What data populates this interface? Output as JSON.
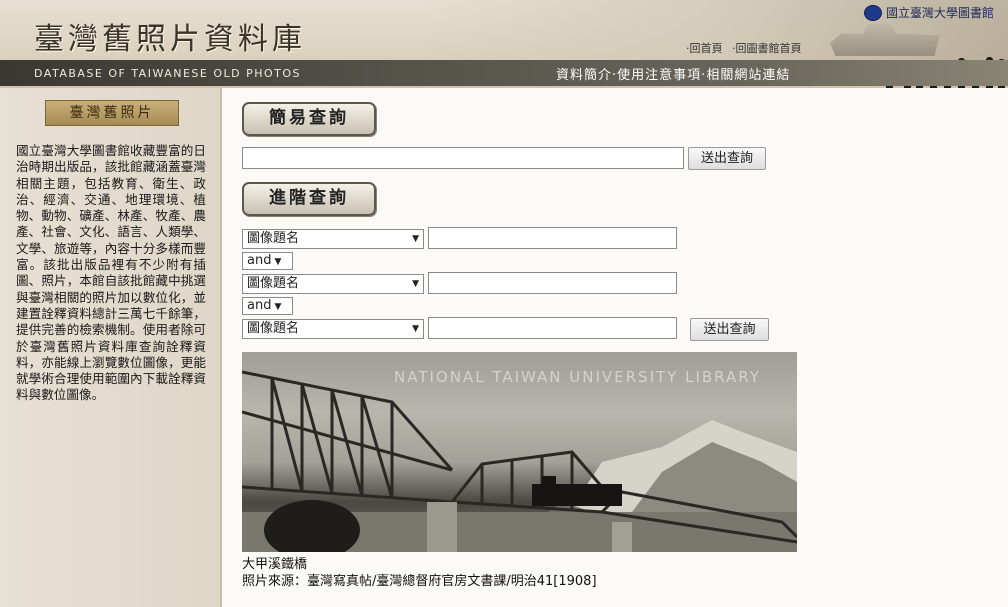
{
  "header": {
    "site_title": "臺灣舊照片資料庫",
    "subtitle_en": "DATABASE OF TAIWANESE OLD PHOTOS",
    "library_name": "國立臺灣大學圖書館",
    "home_links": [
      "‧回首頁",
      "‧回圖書館首頁"
    ],
    "nav": [
      "資料簡介",
      "使用注意事項",
      "相關網站連結"
    ],
    "nav_sep": "‧"
  },
  "sidebar": {
    "badge": "臺灣舊照片",
    "description": "國立臺灣大學圖書館收藏豐富的日治時期出版品，該批館藏涵蓋臺灣相關主題，包括教育、衛生、政治、經濟、交通、地理環境、植物、動物、礦產、林產、牧產、農產、社會、文化、語言、人類學、文學、旅遊等，內容十分多樣而豐富。該批出版品裡有不少附有插圖、照片，本館自該批館藏中挑選與臺灣相關的照片加以數位化，並建置詮釋資料總計三萬七千餘筆，提供完善的檢索機制。使用者除可於臺灣舊照片資料庫查詢詮釋資料，亦能線上瀏覽數位圖像，更能就學術合理使用範圍內下載詮釋資料與數位圖像。"
  },
  "simple_search": {
    "heading": "簡易查詢",
    "query_value": "",
    "submit_label": "送出查詢"
  },
  "advanced_search": {
    "heading": "進階查詢",
    "rows": [
      {
        "field": "圖像題名",
        "value": ""
      },
      {
        "field": "圖像題名",
        "value": ""
      },
      {
        "field": "圖像題名",
        "value": ""
      }
    ],
    "operators": [
      "and",
      "and"
    ],
    "submit_label": "送出查詢"
  },
  "featured_photo": {
    "watermark": "NATIONAL TAIWAN UNIVERSITY LIBRARY",
    "title": "大甲溪鐵橋",
    "source": "照片來源：臺灣寫真帖/臺灣總督府官房文書課/明治41[1908]"
  },
  "colors": {
    "accent_dark": "#3a3833",
    "sidebar_bg": "#e7e0d4"
  }
}
